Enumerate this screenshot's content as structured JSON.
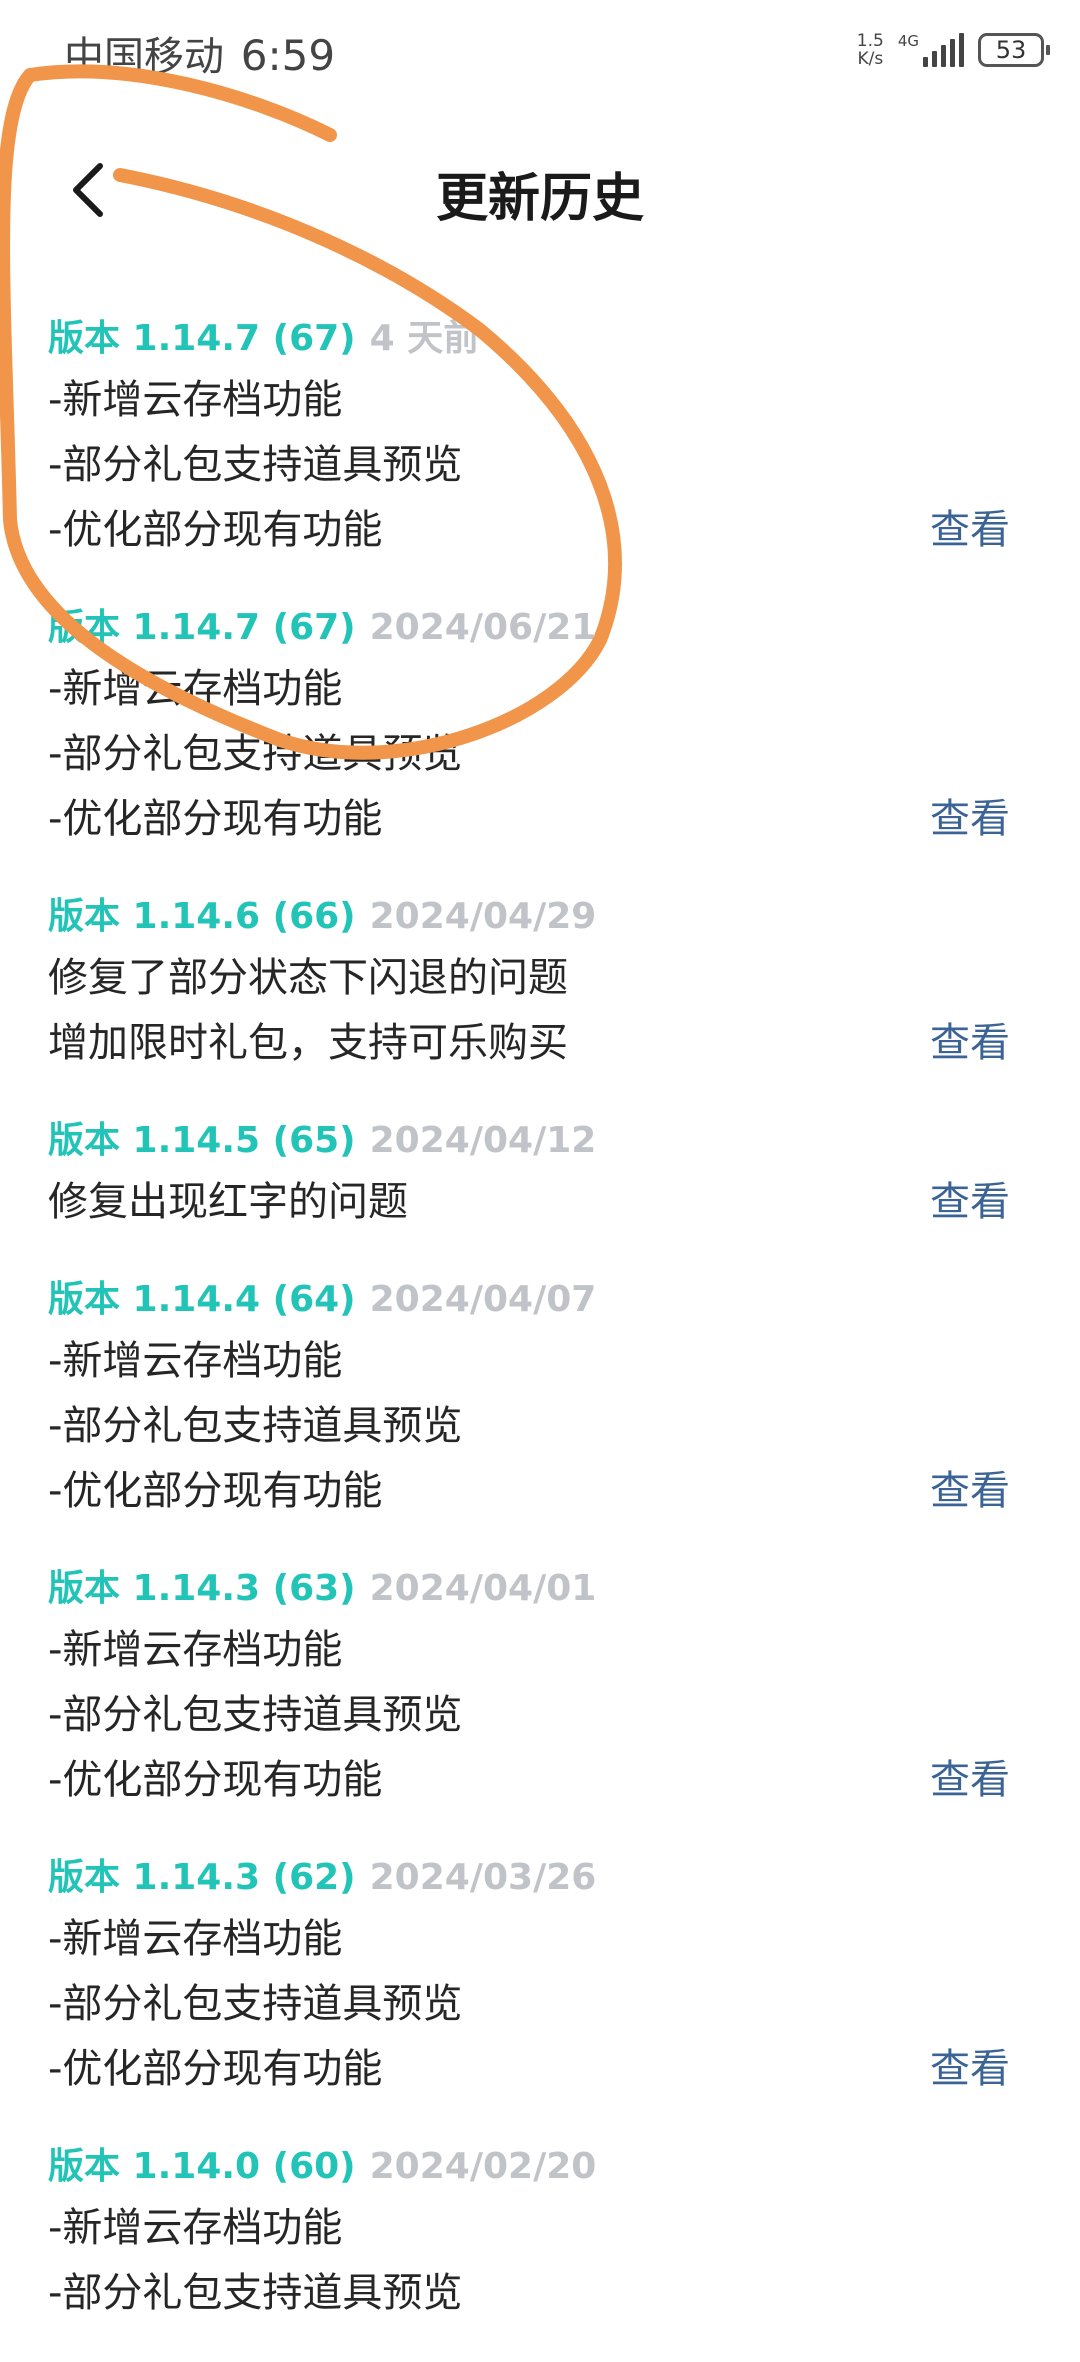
{
  "status_bar": {
    "carrier": "中国移动",
    "time": "6:59",
    "net_speed_value": "1.5",
    "net_speed_unit": "K/s",
    "network_type": "4G",
    "battery": "53"
  },
  "header": {
    "title": "更新历史",
    "back_icon": "chevron-left-icon"
  },
  "colors": {
    "version_label": "#22c4b8",
    "version_date": "#c0c3c8",
    "view_link": "#3b6494",
    "annotation_stroke": "#f0954a"
  },
  "versions": [
    {
      "label": "版本 1.14.7 (67)",
      "date": "4 天前",
      "notes": [
        "-新增云存档功能",
        "-部分礼包支持道具预览",
        "-优化部分现有功能"
      ],
      "view": "查看"
    },
    {
      "label": "版本 1.14.7 (67)",
      "date": "2024/06/21",
      "notes": [
        "-新增云存档功能",
        "-部分礼包支持道具预览",
        "-优化部分现有功能"
      ],
      "view": "查看"
    },
    {
      "label": "版本 1.14.6 (66)",
      "date": "2024/04/29",
      "notes": [
        "修复了部分状态下闪退的问题",
        "增加限时礼包，支持可乐购买"
      ],
      "view": "查看"
    },
    {
      "label": "版本 1.14.5 (65)",
      "date": "2024/04/12",
      "notes": [
        "修复出现红字的问题"
      ],
      "view": "查看"
    },
    {
      "label": "版本 1.14.4 (64)",
      "date": "2024/04/07",
      "notes": [
        "-新增云存档功能",
        "-部分礼包支持道具预览",
        "-优化部分现有功能"
      ],
      "view": "查看"
    },
    {
      "label": "版本 1.14.3 (63)",
      "date": "2024/04/01",
      "notes": [
        "-新增云存档功能",
        "-部分礼包支持道具预览",
        "-优化部分现有功能"
      ],
      "view": "查看"
    },
    {
      "label": "版本 1.14.3 (62)",
      "date": "2024/03/26",
      "notes": [
        "-新增云存档功能",
        "-部分礼包支持道具预览",
        "-优化部分现有功能"
      ],
      "view": "查看"
    },
    {
      "label": "版本 1.14.0 (60)",
      "date": "2024/02/20",
      "notes": [
        "-新增云存档功能",
        "-部分礼包支持道具预览"
      ],
      "view": ""
    }
  ]
}
